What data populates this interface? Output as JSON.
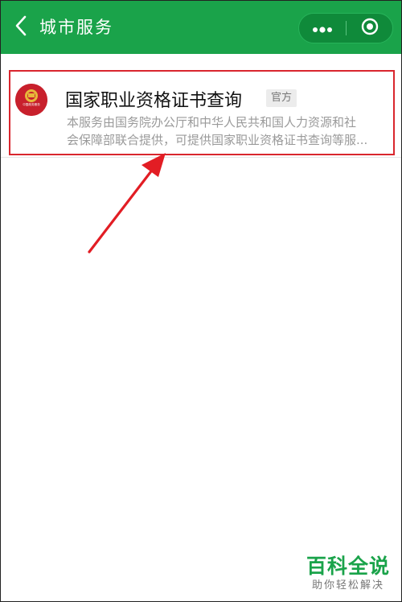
{
  "topbar": {
    "title": "城市服务",
    "back_icon": "chevron-left-icon",
    "more_icon": "more-dots-icon",
    "close_icon": "target-circle-icon",
    "bar_color": "#1aa34a"
  },
  "result": {
    "logo_text": "中国政务服务",
    "title": "国家职业资格证书查询",
    "badge": "官方",
    "desc_line1": "本服务由国务院办公厅和中华人民共和国人力资源和社",
    "desc_line2": "会保障部联合提供，可提供国家职业资格证书查询等服..."
  },
  "annotation": {
    "highlight_color": "#d9262e",
    "arrow_icon": "red-arrow-icon"
  },
  "watermark": {
    "title": "百科全说",
    "subtitle": "助你轻松解决",
    "color": "#1aa34a"
  }
}
